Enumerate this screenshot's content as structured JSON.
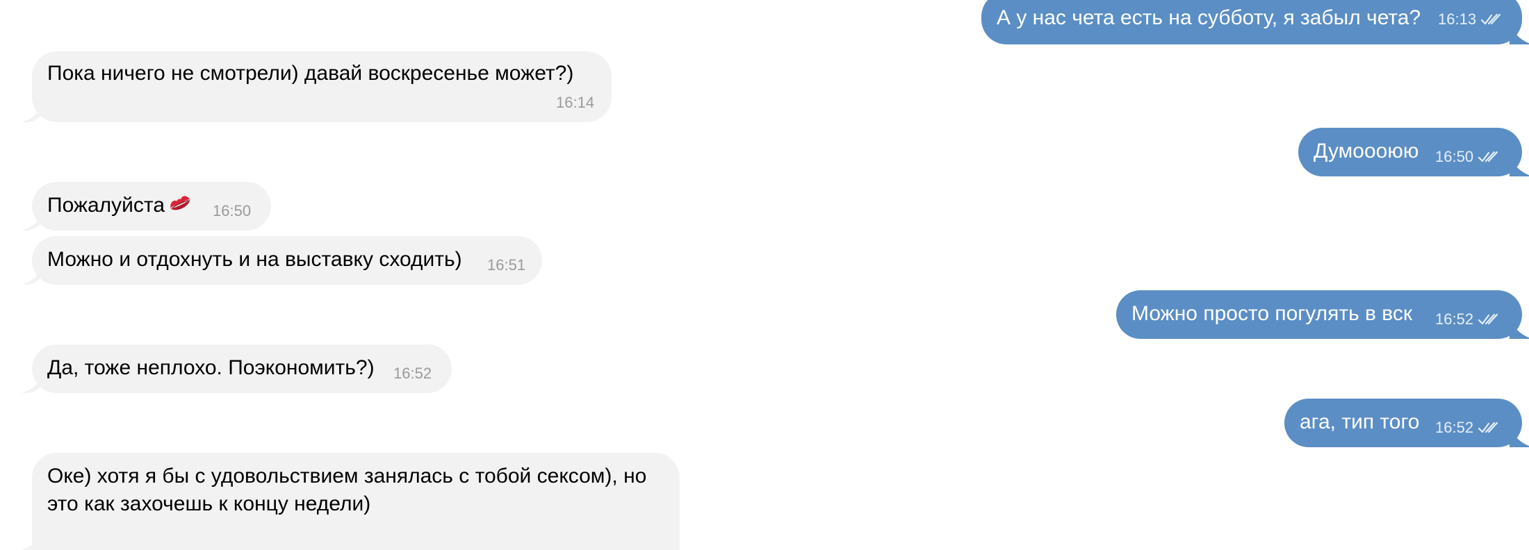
{
  "messages": [
    {
      "id": "m1",
      "direction": "out",
      "text": "А у нас чета есть на субботу, я забыл чета?",
      "time": "16:13",
      "read": true
    },
    {
      "id": "m2",
      "direction": "in",
      "text": "Пока ничего не смотрели) давай воскресенье может?)",
      "time": "16:14"
    },
    {
      "id": "m3",
      "direction": "out",
      "text": "Думоооюю",
      "time": "16:50",
      "read": true
    },
    {
      "id": "m4",
      "direction": "in",
      "text": "Пожалуйста",
      "emoji": "kiss-mark-icon",
      "time": "16:50"
    },
    {
      "id": "m5",
      "direction": "in",
      "text": "Можно и отдохнуть и на выставку сходить)",
      "time": "16:51"
    },
    {
      "id": "m6",
      "direction": "out",
      "text": "Можно просто погулять в вск",
      "time": "16:52",
      "read": true
    },
    {
      "id": "m7",
      "direction": "in",
      "text": "Да, тоже неплохо. Поэкономить?)",
      "time": "16:52"
    },
    {
      "id": "m8",
      "direction": "out",
      "text": "ага, тип того",
      "time": "16:52",
      "read": true
    },
    {
      "id": "m9",
      "direction": "in",
      "text": "Оке) хотя я бы с удовольствием занялась с тобой сексом), но это как захочешь к концу недели)",
      "time": ""
    }
  ],
  "colors": {
    "incoming_bubble": "#f2f2f2",
    "outgoing_bubble": "#5b8ec4",
    "incoming_time": "#9a9a9a",
    "outgoing_time": "#e7f0fa"
  }
}
